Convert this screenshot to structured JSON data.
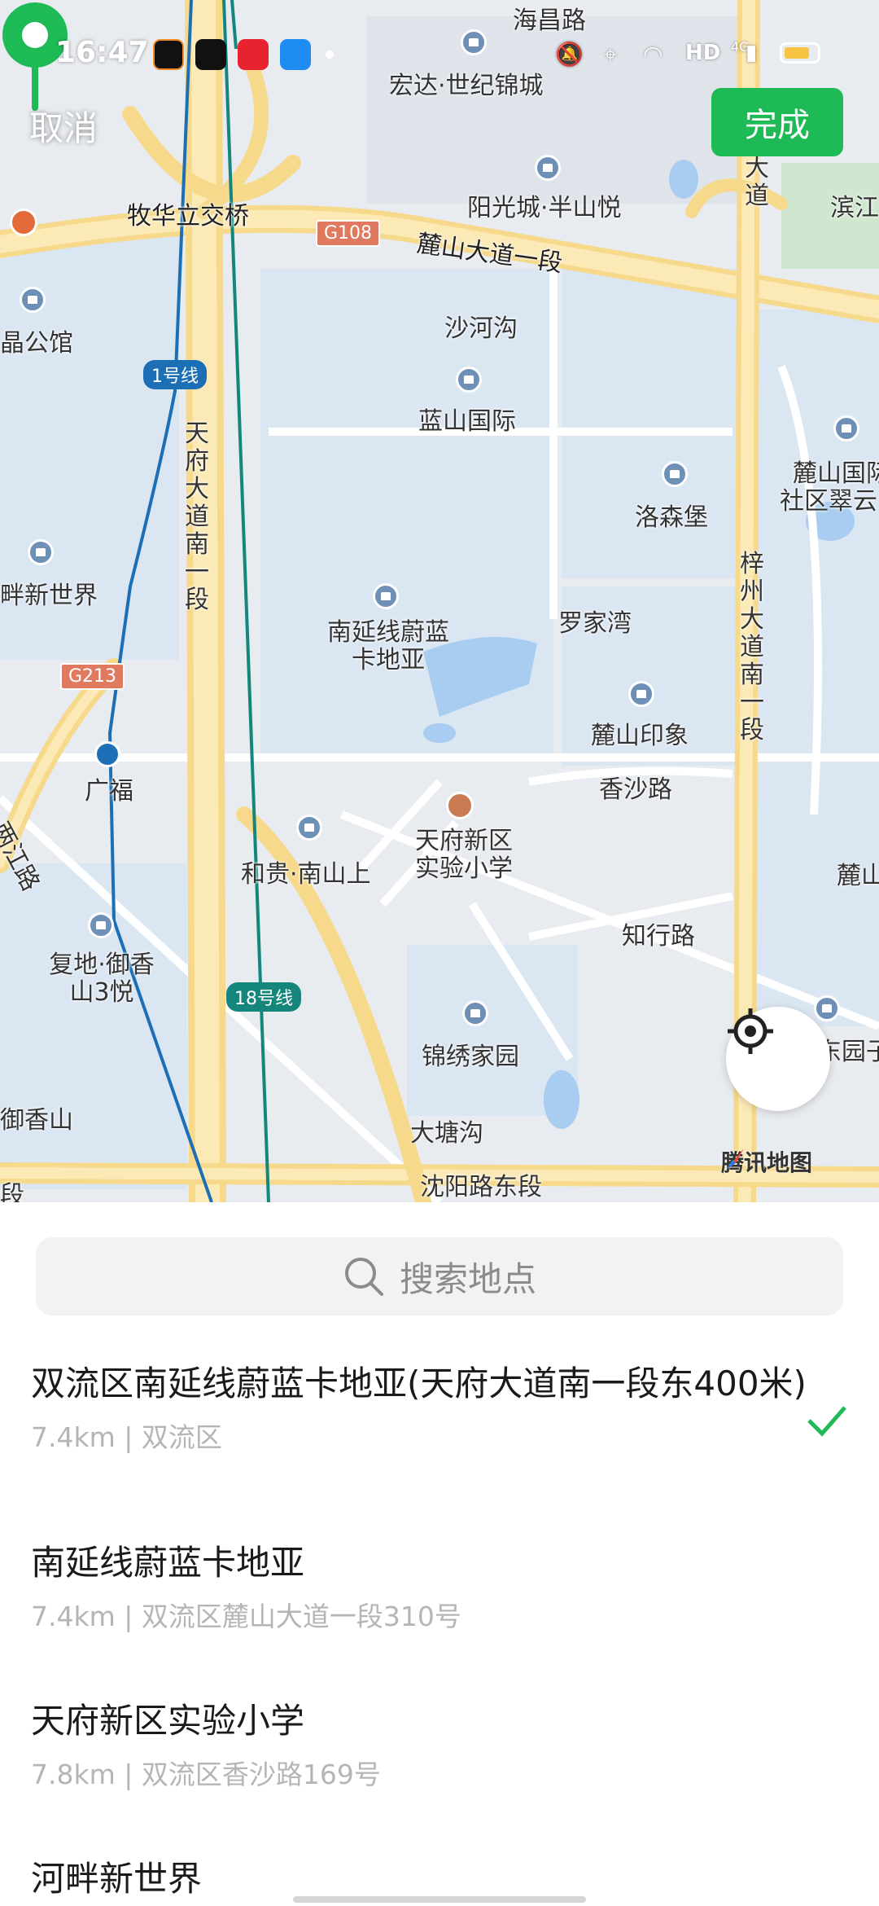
{
  "status_bar": {
    "time": "16:47",
    "network": "HD",
    "signal_label": "4G",
    "apps": [
      {
        "icon": "app-o-icon",
        "color": "#111111"
      },
      {
        "icon": "tiktok-icon",
        "color": "#111111"
      },
      {
        "icon": "xiaohongshu-icon",
        "color": "#e6232e"
      },
      {
        "icon": "browser-icon",
        "color": "#1e8cf0"
      }
    ]
  },
  "header": {
    "cancel_label": "取消",
    "done_label": "完成",
    "accent_color": "#1dba55"
  },
  "map": {
    "labels": {
      "haichang": "海昌路",
      "hongda": "宏达·世纪锦城",
      "yangguang": "阳光城·半山悦",
      "muhua": "牧华立交桥",
      "g108": "G108",
      "lushan1": "麓山大道一段",
      "binjiang": "滨江",
      "dadao_top": "大道",
      "jingpin": "晶公馆",
      "shahegou": "沙河沟",
      "line1": "1号线",
      "lanshan": "蓝山国际",
      "tianfu": "天府大道南一段",
      "lushanguoji": "麓山国际",
      "shequcuiyun": "社区翠云",
      "luosenbao": "洛森堡",
      "panxin": "畔新世界",
      "luojiawan": "罗家湾",
      "nanyan_poi": "南延线蔚蓝卡地亚",
      "g213": "G213",
      "zizhou": "梓州大道南一段",
      "lushanyinxiang": "麓山印象",
      "guangfu": "广福",
      "xiangsha": "香沙路",
      "liangjiang": "两江路",
      "tianfuxinqu": "天府新区实验小学",
      "hegui": "和贵·南山上",
      "lushan_r": "麓山",
      "zhixing": "知行路",
      "fudi": "复地·御香山3悦",
      "line18": "18号线",
      "jinxiu": "锦绣家园",
      "yuanzi": "东园子",
      "yuxiangshan": "御香山",
      "datanggou": "大塘沟",
      "shenyang": "沈阳路东段",
      "duan": "段"
    },
    "brand": "腾讯地图"
  },
  "search": {
    "placeholder": "搜索地点"
  },
  "results": [
    {
      "title": "双流区南延线蔚蓝卡地亚(天府大道南一段东400米)",
      "subtitle": "7.4km | 双流区",
      "selected": true
    },
    {
      "title": "南延线蔚蓝卡地亚",
      "subtitle": "7.4km | 双流区麓山大道一段310号",
      "selected": false
    },
    {
      "title": "天府新区实验小学",
      "subtitle": "7.8km | 双流区香沙路169号",
      "selected": false
    },
    {
      "title": "河畔新世界",
      "subtitle": "",
      "selected": false
    }
  ]
}
